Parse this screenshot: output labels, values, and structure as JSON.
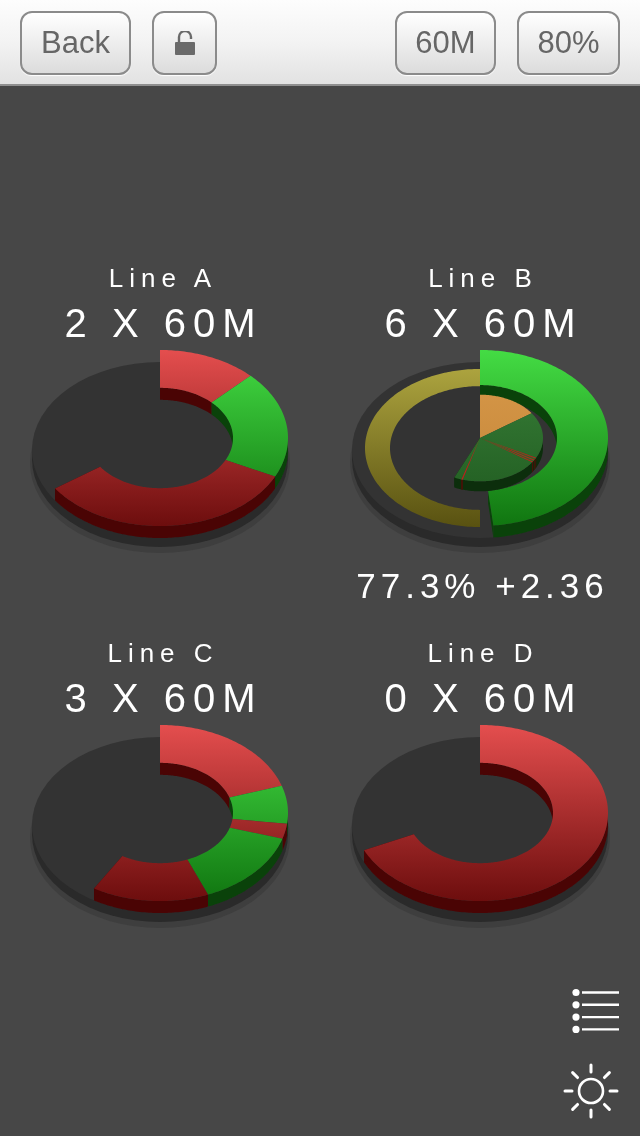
{
  "toolbar": {
    "back_button": "Back",
    "lock_button": {
      "locked": false
    },
    "right_buttons": [
      "60M",
      "80%"
    ]
  },
  "gauges": [
    {
      "title": "Line A",
      "value": "2 X 60M"
    },
    {
      "title": "Line B",
      "value": "6 X 60M",
      "reading": "77.3% +2.36"
    },
    {
      "title": "Line C",
      "value": "3 X 60M"
    },
    {
      "title": "Line D",
      "value": "0 X 60M"
    }
  ]
}
